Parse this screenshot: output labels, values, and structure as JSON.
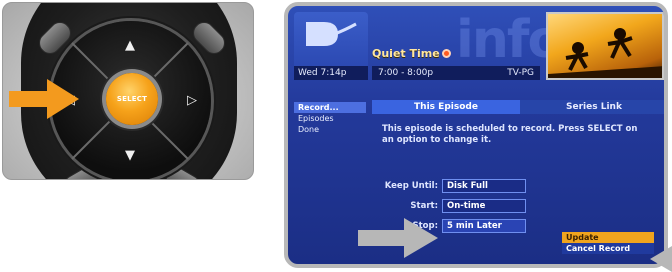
{
  "remote": {
    "select_label": "SELECT",
    "arrows": {
      "up": "▲",
      "down": "▼",
      "left": "◁",
      "right": "▷"
    }
  },
  "tv": {
    "date": "Wed 7:14p",
    "program_title": "Quiet Time",
    "time_range": "7:00 - 8:00p",
    "rating": "TV-PG",
    "watermark": "info",
    "menu": [
      "Record...",
      "Episodes",
      "Done"
    ],
    "tabs": [
      "This Episode",
      "Series Link"
    ],
    "description": "This episode is scheduled to record. Press SELECT on an option to change it.",
    "fields": [
      {
        "label": "Keep Until:",
        "value": "Disk Full"
      },
      {
        "label": "Start:",
        "value": "On-time"
      },
      {
        "label": "Stop:",
        "value": "5 min Later"
      }
    ],
    "actions": [
      "Update",
      "Cancel Record"
    ]
  },
  "colors": {
    "accent_orange": "#f39a1e",
    "screen_blue": "#23399a",
    "highlight_orange": "#f0a41e"
  },
  "icons": {
    "pointer_left": "orange-arrow-icon",
    "pointer_tv": "gray-arrow-icon"
  }
}
